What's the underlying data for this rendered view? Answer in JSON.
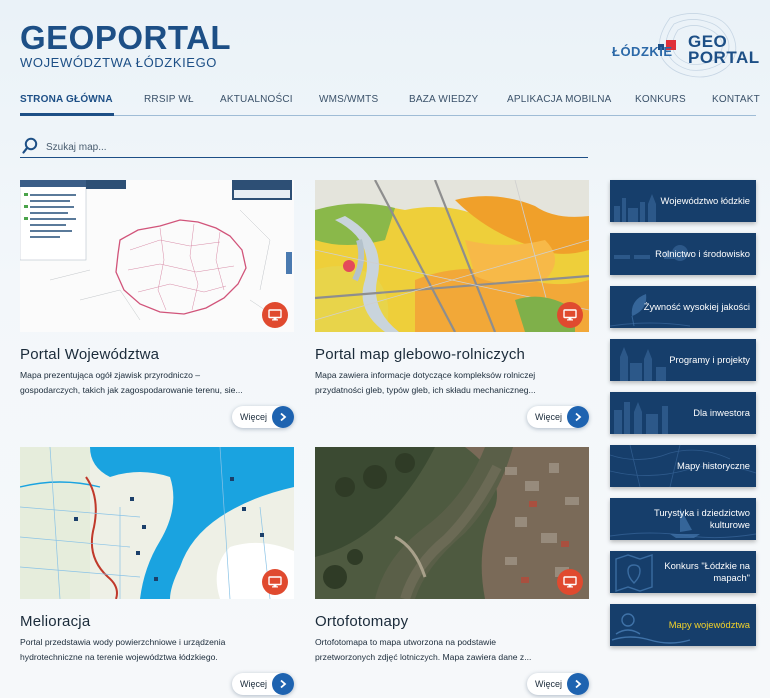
{
  "header": {
    "logo_title": "GEOPORTAL",
    "logo_subtitle": "WOJEWÓDZTWA ŁÓDZKIEGO",
    "right_logo_top": "GEO",
    "right_logo_bottom": "PORTAL",
    "right_logo_region": "ŁÓDZKIE"
  },
  "nav": {
    "items": [
      {
        "label": "STRONA GŁÓWNA",
        "active": true
      },
      {
        "label": "RRSIP WŁ",
        "active": false
      },
      {
        "label": "AKTUALNOŚCI",
        "active": false
      },
      {
        "label": "WMS/WMTS",
        "active": false
      },
      {
        "label": "BAZA WIEDZY",
        "active": false
      },
      {
        "label": "APLIKACJA MOBILNA",
        "active": false
      },
      {
        "label": "KONKURS",
        "active": false
      },
      {
        "label": "KONTAKT",
        "active": false
      }
    ]
  },
  "search": {
    "placeholder": "Szukaj map..."
  },
  "cards": [
    {
      "title": "Portal Województwa",
      "desc_line1": "Mapa prezentująca ogół zjawisk przyrodniczo –",
      "desc_line2": "gospodarczych, takich jak zagospodarowanie terenu, sie...",
      "more_label": "Więcej"
    },
    {
      "title": "Portal map glebowo-rolniczych",
      "desc_line1": "Mapa zawiera informacje dotyczące kompleksów rolniczej",
      "desc_line2": "przydatności gleb, typów gleb, ich składu mechaniczneg...",
      "more_label": "Więcej"
    },
    {
      "title": "Melioracja",
      "desc_line1": "Portal przedstawia wody powierzchniowe i urządzenia",
      "desc_line2": "hydrotechniczne na terenie województwa łódzkiego.",
      "more_label": "Więcej"
    },
    {
      "title": "Ortofotomapy",
      "desc_line1": "Ortofotomapa to mapa utworzona na podstawie",
      "desc_line2": "przetworzonych zdjęć lotniczych. Mapa zawiera dane z...",
      "more_label": "Więcej"
    }
  ],
  "sidebar": {
    "items": [
      {
        "label": "Województwo łódzkie",
        "highlight": false
      },
      {
        "label": "Rolnictwo i środowisko",
        "highlight": false
      },
      {
        "label": "Żywność wysokiej jakości",
        "highlight": false
      },
      {
        "label": "Programy i projekty",
        "highlight": false
      },
      {
        "label": "Dla inwestora",
        "highlight": false
      },
      {
        "label": "Mapy historyczne",
        "highlight": false
      },
      {
        "label": "Turystyka i dziedzictwo kulturowe",
        "highlight": false
      },
      {
        "label": "Konkurs \"Łódzkie na mapach\"",
        "highlight": false
      },
      {
        "label": "Mapy województwa",
        "highlight": true
      }
    ]
  },
  "colors": {
    "brand": "#1d4f86",
    "sidebar_bg": "#163e6b",
    "badge": "#e04a2f",
    "arrow": "#1e63b0",
    "highlight_text": "#f2d22a"
  },
  "icons": {
    "search": "search-icon",
    "monitor": "monitor-icon",
    "arrow": "chevron-right-icon"
  }
}
